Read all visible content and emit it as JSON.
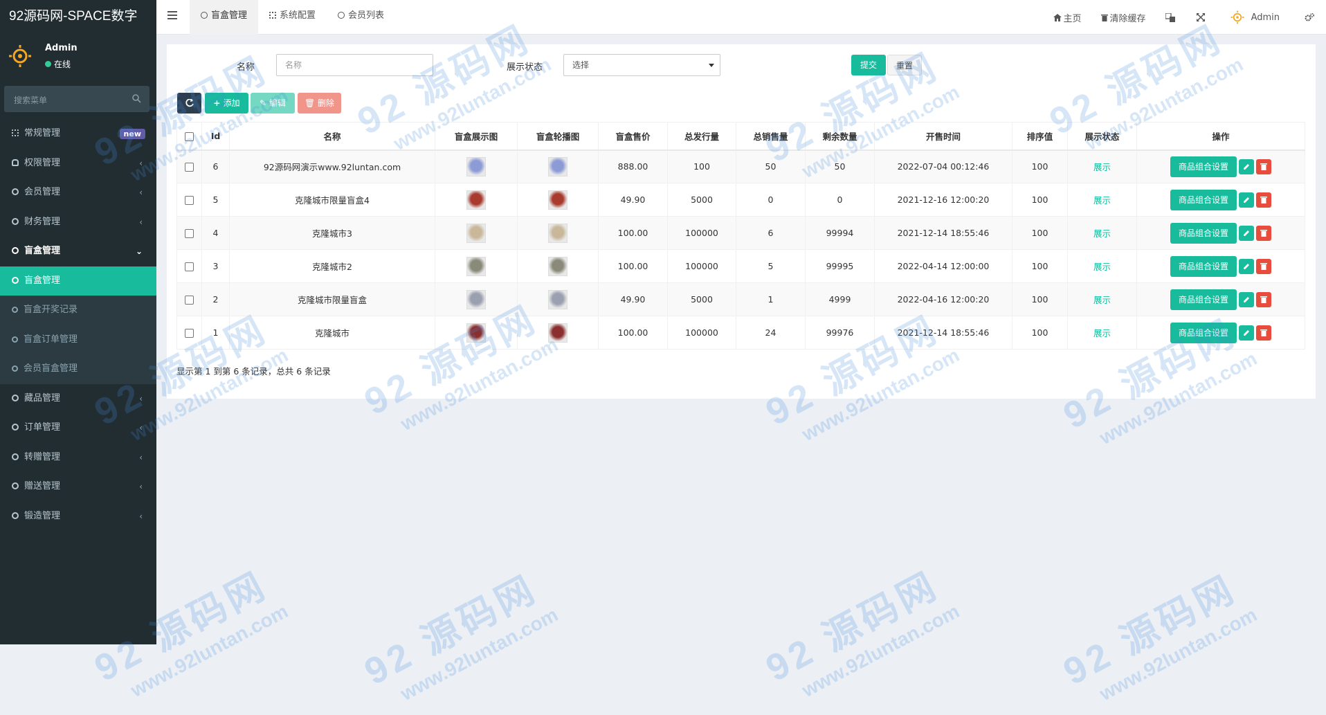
{
  "app": {
    "title": "92源码网-SPACE数字"
  },
  "user": {
    "name": "Admin",
    "status": "在线"
  },
  "sidebar": {
    "search_placeholder": "搜索菜单",
    "items": [
      {
        "label": "常规管理",
        "badge": "new"
      },
      {
        "label": "权限管理"
      },
      {
        "label": "会员管理"
      },
      {
        "label": "财务管理"
      },
      {
        "label": "盲盒管理"
      },
      {
        "label": "盲盒管理"
      },
      {
        "label": "盲盒开奖记录"
      },
      {
        "label": "盲盒订单管理"
      },
      {
        "label": "会员盲盒管理"
      },
      {
        "label": "藏品管理"
      },
      {
        "label": "订单管理"
      },
      {
        "label": "转赠管理"
      },
      {
        "label": "赠送管理"
      },
      {
        "label": "锻造管理"
      }
    ]
  },
  "topbar": {
    "tabs": [
      {
        "label": "盲盒管理"
      },
      {
        "label": "系统配置"
      },
      {
        "label": "会员列表"
      }
    ],
    "home": "主页",
    "clear_cache": "清除缓存",
    "user": "Admin"
  },
  "filter": {
    "name_label": "名称",
    "name_placeholder": "名称",
    "status_label": "展示状态",
    "status_value": "选择",
    "submit": "提交",
    "reset": "重置"
  },
  "toolbar": {
    "add": "添加",
    "edit": "编辑",
    "delete": "删除"
  },
  "table": {
    "headers": [
      "Id",
      "名称",
      "盲盒展示图",
      "盲盒轮播图",
      "盲盒售价",
      "总发行量",
      "总销售量",
      "剩余数量",
      "开售时间",
      "排序值",
      "展示状态",
      "操作"
    ],
    "rows": [
      {
        "id": "6",
        "name": "92源码网演示www.92luntan.com",
        "price": "888.00",
        "total": "100",
        "sold": "50",
        "left": "50",
        "time": "2022-07-04 00:12:46",
        "sort": "100",
        "status": "展示",
        "action": "商品组合设置"
      },
      {
        "id": "5",
        "name": "克隆城市限量盲盒4",
        "price": "49.90",
        "total": "5000",
        "sold": "0",
        "left": "0",
        "time": "2021-12-16 12:00:20",
        "sort": "100",
        "status": "展示",
        "action": "商品组合设置"
      },
      {
        "id": "4",
        "name": "克隆城市3",
        "price": "100.00",
        "total": "100000",
        "sold": "6",
        "left": "99994",
        "time": "2021-12-14 18:55:46",
        "sort": "100",
        "status": "展示",
        "action": "商品组合设置"
      },
      {
        "id": "3",
        "name": "克隆城市2",
        "price": "100.00",
        "total": "100000",
        "sold": "5",
        "left": "99995",
        "time": "2022-04-14 12:00:00",
        "sort": "100",
        "status": "展示",
        "action": "商品组合设置"
      },
      {
        "id": "2",
        "name": "克隆城市限量盲盒",
        "price": "49.90",
        "total": "5000",
        "sold": "1",
        "left": "4999",
        "time": "2022-04-16 12:00:20",
        "sort": "100",
        "status": "展示",
        "action": "商品组合设置"
      },
      {
        "id": "1",
        "name": "克隆城市",
        "price": "100.00",
        "total": "100000",
        "sold": "24",
        "left": "99976",
        "time": "2021-12-14 18:55:46",
        "sort": "100",
        "status": "展示",
        "action": "商品组合设置"
      }
    ]
  },
  "pager": {
    "text": "显示第 1 到第 6 条记录，总共 6 条记录"
  },
  "watermark": {
    "big": "92 源码网",
    "small": "www.92luntan.com"
  },
  "colors": {
    "accent": "#18bc9c",
    "sidebar": "#222d32",
    "danger": "#e74c3c",
    "thumbs": [
      "#8c9bd6",
      "#a83a2e",
      "#c9b79a",
      "#8a8a7a",
      "#9aa0b0",
      "#8b2e2e"
    ]
  }
}
